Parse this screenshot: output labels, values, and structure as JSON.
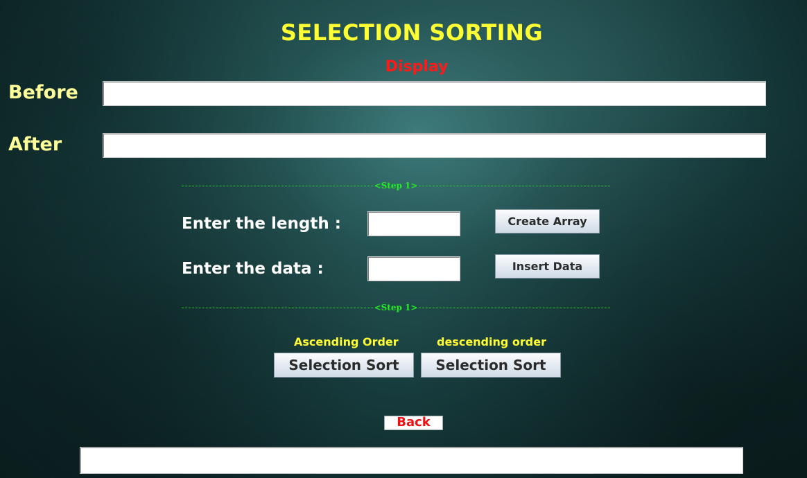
{
  "header": {
    "title": "SELECTION SORTING",
    "display_label": "Display"
  },
  "display": {
    "before_label": "Before",
    "before_value": "",
    "after_label": "After",
    "after_value": ""
  },
  "steps": {
    "step1_label": "<Step 1>",
    "step2_label": "<Step 1>"
  },
  "form": {
    "length_label": "Enter the length :",
    "length_value": "",
    "data_label": "Enter the data :",
    "data_value": "",
    "create_array_label": "Create Array",
    "insert_data_label": "Insert Data"
  },
  "sort": {
    "ascending_label": "Ascending Order",
    "ascending_button": "Selection Sort",
    "descending_label": "descending order",
    "descending_button": "Selection Sort"
  },
  "footer": {
    "back_label": "Back",
    "status_value": ""
  },
  "colors": {
    "title": "#ffff33",
    "display_label": "#ff1a1a",
    "side_label": "#ffff99",
    "step_line": "#22ee22",
    "back_text": "#ee1111"
  }
}
